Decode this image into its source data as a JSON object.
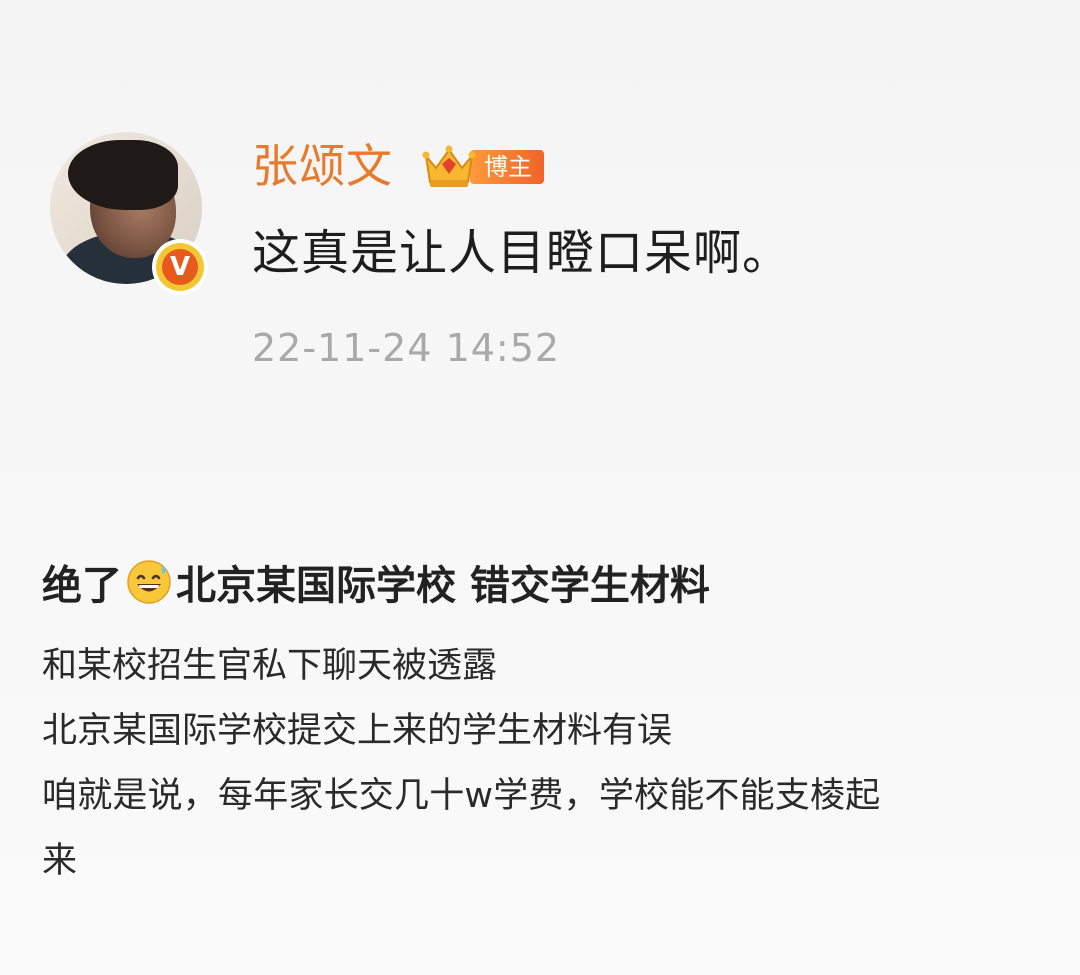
{
  "post": {
    "author_name": "张颂文",
    "badge_label": "博主",
    "verified_mark": "V",
    "text": "这真是让人目瞪口呆啊。",
    "timestamp": "22-11-24 14:52"
  },
  "article": {
    "title_prefix": "绝了",
    "title_emoji": "sweat-smile-icon",
    "title_suffix": "北京某国际学校 错交学生材料",
    "lines": [
      "和某校招生官私下聊天被透露",
      "北京某国际学校提交上来的学生材料有误",
      "咱就是说，每年家长交几十w学费，学校能不能支棱起",
      "来"
    ]
  },
  "colors": {
    "author_orange": "#e77b2d",
    "badge_gradient_start": "#ff9a3c",
    "badge_gradient_end": "#f0632a",
    "timestamp_gray": "#a9a9a9"
  }
}
